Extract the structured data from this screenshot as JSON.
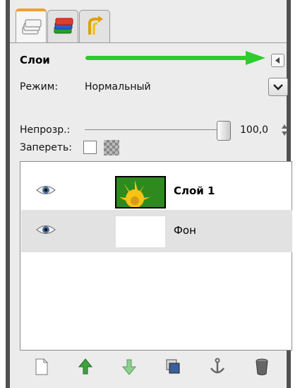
{
  "tabs": [
    {
      "name": "layers",
      "icon": "layers-icon"
    },
    {
      "name": "channels",
      "icon": "channels-icon"
    },
    {
      "name": "undo-history",
      "icon": "undo-history-icon"
    }
  ],
  "panel": {
    "title": "Слои",
    "mode_label": "Режим:",
    "mode_value": "Нормальный",
    "opacity_label": "Непрозр.:",
    "opacity_value": "100,0",
    "lock_label": "Запереть:"
  },
  "layers": [
    {
      "name": "Слой 1",
      "visible": true,
      "selected": false
    },
    {
      "name": "Фон",
      "visible": true,
      "selected": true
    }
  ],
  "colors": {
    "annotation_arrow": "#2ecc2e",
    "panel_bg": "#ececec",
    "row_highlight": "#e2e2e2"
  },
  "bottom_icons": [
    "new-layer-icon",
    "raise-layer-icon",
    "lower-layer-icon",
    "duplicate-layer-icon",
    "anchor-layer-icon",
    "delete-layer-icon"
  ]
}
